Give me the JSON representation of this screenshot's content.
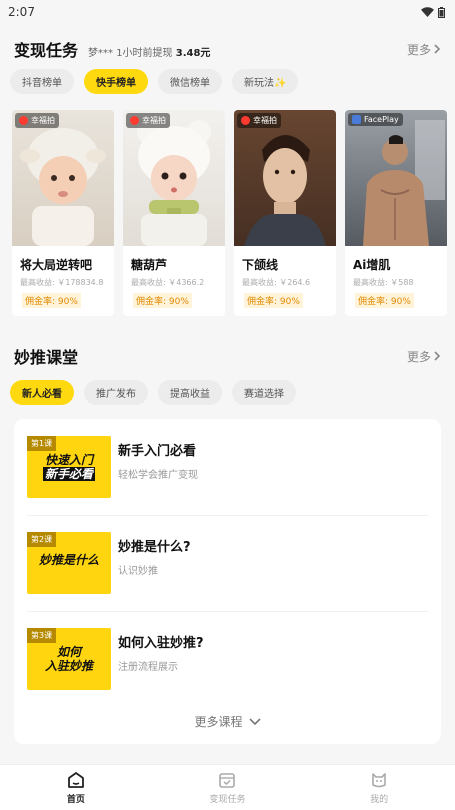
{
  "status": {
    "time": "2:07"
  },
  "earn": {
    "title": "变现任务",
    "note_prefix": "梦*** 1小时前提现",
    "note_amount": "3.48元",
    "more": "更多",
    "tabs": [
      {
        "label": "抖音榜单",
        "active": false
      },
      {
        "label": "快手榜单",
        "active": true
      },
      {
        "label": "微信榜单",
        "active": false
      },
      {
        "label": "新玩法✨",
        "active": false
      }
    ],
    "cards": [
      {
        "app": "幸福拍",
        "name": "将大局逆转吧",
        "earn": "最高收益: ￥178834.8",
        "rate": "佣金率: 90%"
      },
      {
        "app": "幸福拍",
        "name": "糖葫芦",
        "earn": "最高收益: ￥4366.2",
        "rate": "佣金率: 90%"
      },
      {
        "app": "幸福拍",
        "name": "下颌线",
        "earn": "最高收益: ￥264.6",
        "rate": "佣金率: 90%"
      },
      {
        "app": "FacePlay",
        "name": "Ai增肌",
        "earn": "最高收益: ￥588",
        "rate": "佣金率: 90%"
      }
    ]
  },
  "course": {
    "title": "妙推课堂",
    "more": "更多",
    "tabs": [
      {
        "label": "新人必看",
        "active": true
      },
      {
        "label": "推广发布",
        "active": false
      },
      {
        "label": "提高收益",
        "active": false
      },
      {
        "label": "赛道选择",
        "active": false
      }
    ],
    "lessons": [
      {
        "badge": "第1课",
        "cover_line1": "快速入门",
        "cover_line2": "新手必看",
        "title": "新手入门必看",
        "subtitle": "轻松学会推广变现"
      },
      {
        "badge": "第2课",
        "cover_line1": "妙推是什么",
        "cover_line2": "",
        "title": "妙推是什么?",
        "subtitle": "认识妙推"
      },
      {
        "badge": "第3课",
        "cover_line1": "如何",
        "cover_line2": "入驻妙推",
        "title": "如何入驻妙推?",
        "subtitle": "注册流程展示"
      }
    ],
    "more_courses": "更多课程"
  },
  "tabbar": [
    {
      "label": "首页",
      "icon": "home-icon",
      "active": true
    },
    {
      "label": "变现任务",
      "icon": "task-icon",
      "active": false
    },
    {
      "label": "我的",
      "icon": "profile-icon",
      "active": false
    }
  ],
  "colors": {
    "accent": "#ffd90f",
    "rate": "#e08a00"
  }
}
